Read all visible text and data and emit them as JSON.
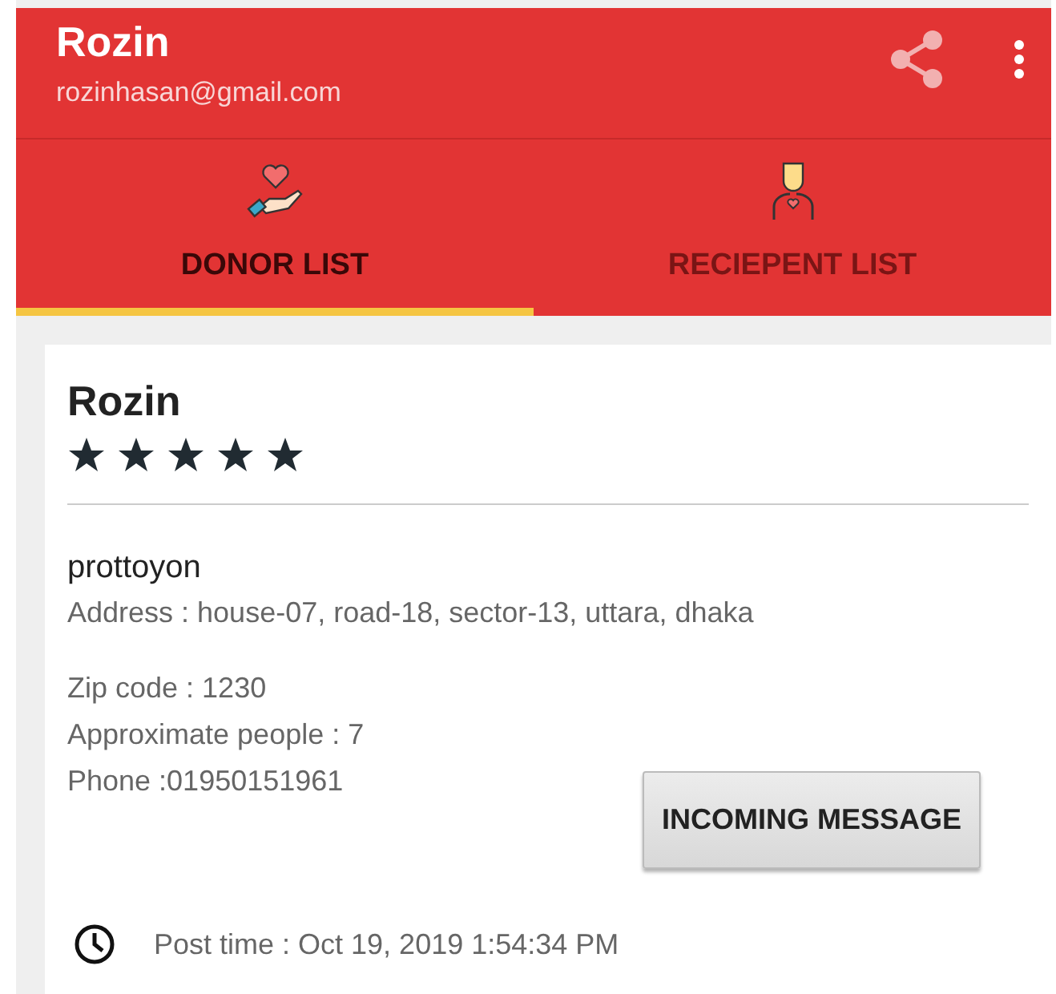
{
  "app_bar": {
    "title": "Rozin",
    "subtitle": "rozinhasan@gmail.com"
  },
  "tabs": [
    {
      "label": "DONOR LIST",
      "kind": "donor",
      "selected": true
    },
    {
      "label": "RECIEPENT LIST",
      "kind": "recipient",
      "selected": false
    }
  ],
  "card": {
    "name": "Rozin",
    "stars": 5,
    "place": "prottoyon",
    "address": "Address : house-07, road-18, sector-13, uttara, dhaka",
    "details": [
      "Zip code : 1230",
      "Approximate people : 7",
      "Phone :01950151961"
    ],
    "button": "INCOMING MESSAGE",
    "post_time": "Post time : Oct 19, 2019 1:54:34 PM"
  }
}
